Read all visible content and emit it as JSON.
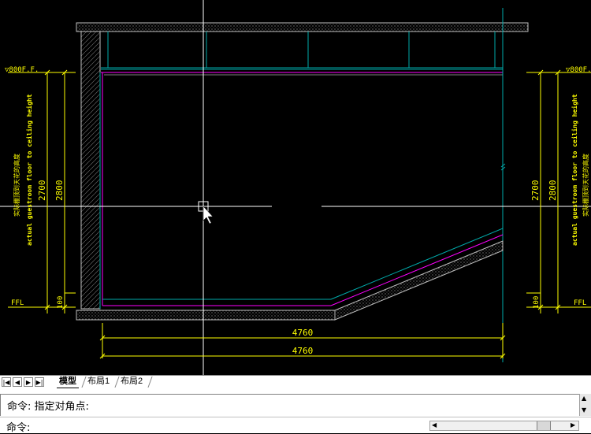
{
  "drawing": {
    "level_top_left": "▽800F.F.",
    "level_top_right": "▽800F.F.",
    "level_bottom_left": "FFL",
    "level_bottom_right": "FFL",
    "vertical_note_cn": "实际棚顶到天花的高度",
    "vertical_note_en": "actual guestroom floor to ceiling height",
    "dim_2700": "2700",
    "dim_2800": "2800",
    "dim_100": "100",
    "dim_width_1": "4760",
    "dim_width_2": "4760"
  },
  "tabs": {
    "model": "模型",
    "layout1": "布局1",
    "layout2": "布局2"
  },
  "command": {
    "history_line": "命令: 指定对角点:",
    "prompt": "命令:"
  },
  "colors": {
    "background": "#000000",
    "dim_yellow": "#ffff00",
    "wall_gray": "#bfbfbf",
    "cyan_line": "#00aaaa",
    "magenta_line": "#ff00ff",
    "crosshair": "#ffffff"
  }
}
